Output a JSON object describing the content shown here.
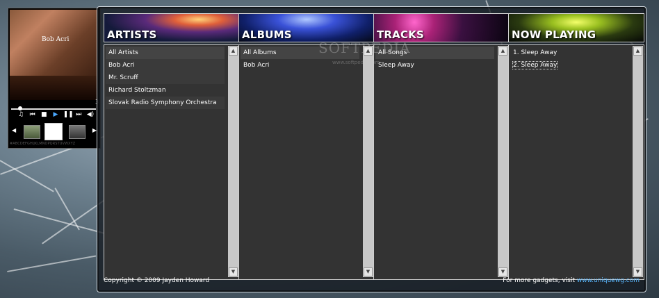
{
  "player": {
    "cover_artist": "Bob Acri",
    "track_count": "3",
    "alphabet": "#ABCDEFGHIJKLMNOPQRSTUVWXYZ",
    "controls": [
      "music-note-icon",
      "prev-icon",
      "stop-icon",
      "play-icon",
      "pause-icon",
      "next-icon",
      "volume-icon"
    ]
  },
  "columns": {
    "artists": {
      "title": "ARTISTS",
      "items": [
        "All Artists",
        "Bob Acri",
        "Mr. Scruff",
        "Richard Stoltzman",
        "Slovak Radio Symphony Orchestra"
      ]
    },
    "albums": {
      "title": "ALBUMS",
      "items": [
        "All Albums",
        "Bob Acri"
      ]
    },
    "tracks": {
      "title": "TRACKS",
      "items": [
        "All Songs",
        "Sleep Away"
      ]
    },
    "now_playing": {
      "title": "NOW PLAYING",
      "items": [
        "1. Sleep Away",
        "2. Sleep Away"
      ]
    }
  },
  "footer": {
    "copyright": "Copyright © 2009 Jayden Howard",
    "more_text": "For more gadgets, visit ",
    "link_text": "www.uniquewg.com"
  },
  "watermark": {
    "main": "SOFTPEDIA",
    "sub": "www.softpedia.com"
  }
}
